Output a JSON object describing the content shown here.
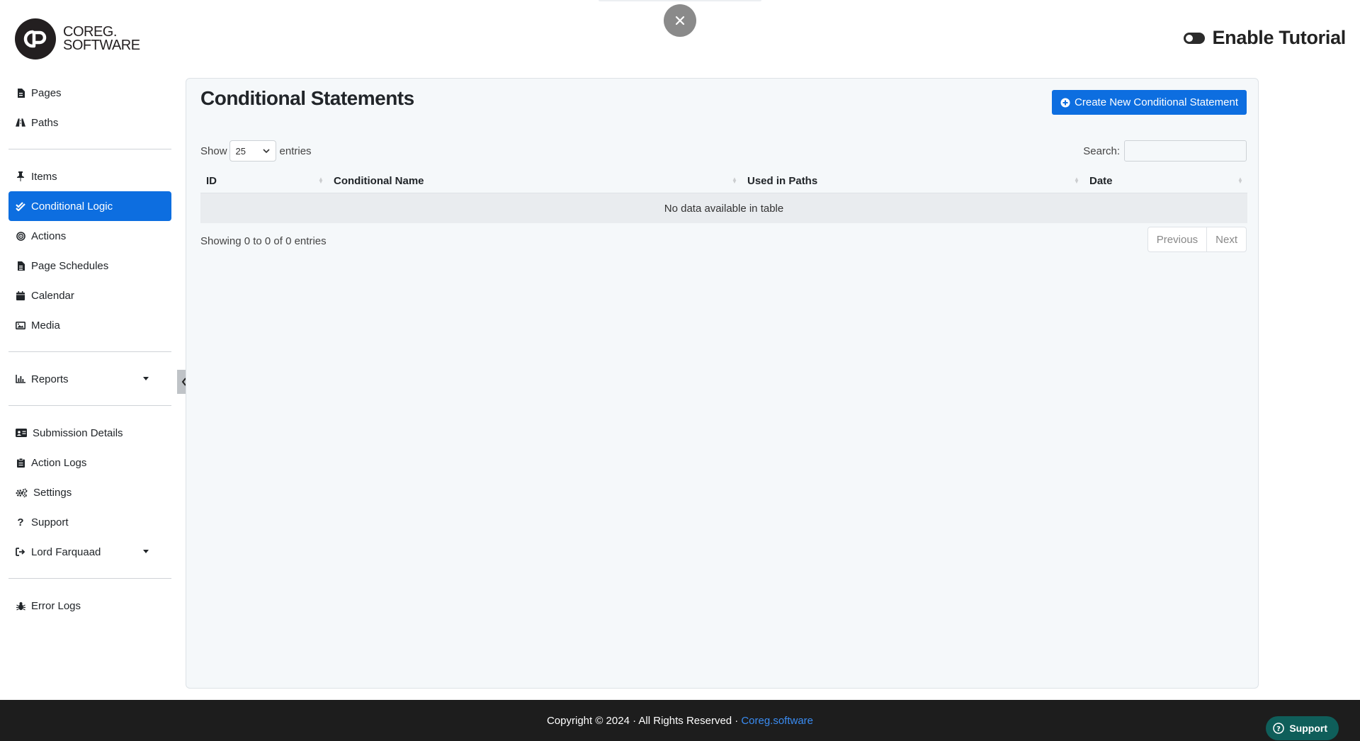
{
  "brand": {
    "line1": "COREG.",
    "line2": "SOFTWARE",
    "mark": "CP"
  },
  "header": {
    "tutorial_label": "Enable Tutorial"
  },
  "sidebar": {
    "group1": [
      {
        "label": "Pages",
        "icon": "file-icon"
      },
      {
        "label": "Paths",
        "icon": "road-icon"
      }
    ],
    "group2": [
      {
        "label": "Items",
        "icon": "pin-icon"
      },
      {
        "label": "Conditional Logic",
        "icon": "check-double-icon",
        "active": true
      },
      {
        "label": "Actions",
        "icon": "bullseye-icon"
      },
      {
        "label": "Page Schedules",
        "icon": "file-lines-icon"
      },
      {
        "label": "Calendar",
        "icon": "calendar-icon"
      },
      {
        "label": "Media",
        "icon": "image-icon"
      }
    ],
    "group3": [
      {
        "label": "Reports",
        "icon": "chart-icon"
      }
    ],
    "group4": [
      {
        "label": "Submission Details",
        "icon": "id-card-icon"
      },
      {
        "label": "Action Logs",
        "icon": "clipboard-icon"
      },
      {
        "label": "Settings",
        "icon": "gears-icon"
      },
      {
        "label": "Support",
        "icon": "question-icon"
      },
      {
        "label": "Lord Farquaad",
        "icon": "sign-out-icon"
      }
    ],
    "group5": [
      {
        "label": "Error Logs",
        "icon": "bug-icon"
      }
    ]
  },
  "main": {
    "title": "Conditional Statements",
    "create_button": "Create New Conditional Statement",
    "show_label": "Show",
    "entries_label": "entries",
    "page_size": "25",
    "search_label": "Search:",
    "search_value": "",
    "columns": [
      "ID",
      "Conditional Name",
      "Used in Paths",
      "Date"
    ],
    "empty_message": "No data available in table",
    "info": "Showing 0 to 0 of 0 entries",
    "pager": {
      "previous": "Previous",
      "next": "Next"
    }
  },
  "footer": {
    "copyright": "Copyright © 2024 · All Rights Reserved ·",
    "link": "Coreg.software",
    "support_label": "Support"
  },
  "colors": {
    "accent": "#0d6ee0",
    "footer_bg": "#1d1d1d",
    "support_bg": "#0f5e5a",
    "panel_bg": "#f5f8fa"
  }
}
